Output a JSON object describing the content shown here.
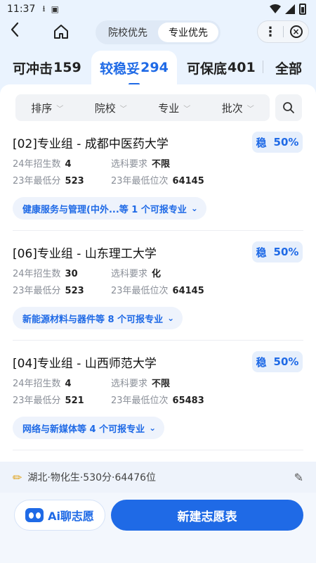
{
  "status_bar": {
    "time": "11:37"
  },
  "segment": {
    "options": [
      "院校优先",
      "专业优先"
    ],
    "active": "专业优先"
  },
  "tabs": [
    {
      "label": "可冲击",
      "count": "159"
    },
    {
      "label": "较稳妥",
      "count": "294"
    },
    {
      "label": "可保底",
      "count": "401"
    },
    {
      "label": "全部",
      "count": ""
    }
  ],
  "filters": [
    "排序",
    "院校",
    "专业",
    "批次"
  ],
  "cards": [
    {
      "title": "[02]专业组 - 成都中医药大学",
      "badge_word": "稳",
      "badge_pct": "50%",
      "enroll_label": "24年招生数",
      "enroll": "4",
      "subject_label": "选科要求",
      "subject": "不限",
      "min_score_label": "23年最低分",
      "min_score": "523",
      "min_rank_label": "23年最低位次",
      "min_rank": "64145",
      "majors": "健康服务与管理(中外...等 1 个可报专业"
    },
    {
      "title": "[06]专业组 - 山东理工大学",
      "badge_word": "稳",
      "badge_pct": "50%",
      "enroll_label": "24年招生数",
      "enroll": "30",
      "subject_label": "选科要求",
      "subject": "化",
      "min_score_label": "23年最低分",
      "min_score": "523",
      "min_rank_label": "23年最低位次",
      "min_rank": "64145",
      "majors": "新能源材料与器件等 8 个可报专业"
    },
    {
      "title": "[04]专业组 - 山西师范大学",
      "badge_word": "稳",
      "badge_pct": "50%",
      "enroll_label": "24年招生数",
      "enroll": "4",
      "subject_label": "选科要求",
      "subject": "不限",
      "min_score_label": "23年最低分",
      "min_score": "521",
      "min_rank_label": "23年最低位次",
      "min_rank": "65483",
      "majors": "网络与新媒体等 4 个可报专业"
    }
  ],
  "profile": {
    "text": "湖北·物化生·530分·64476位"
  },
  "actions": {
    "ai_label": "Ai聊志愿",
    "new_label": "新建志愿表"
  },
  "colors": {
    "accent": "#1f6ae6",
    "background": "#eaf3fe"
  }
}
